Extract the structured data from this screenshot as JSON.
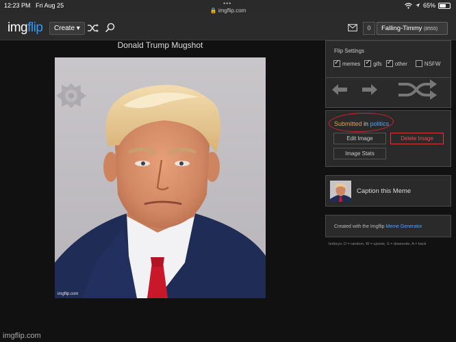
{
  "status_bar": {
    "time": "12:23 PM",
    "date": "Fri Aug 25",
    "url": "🔒 imgflip.com",
    "battery_text": "65%",
    "battery_level": 0.65
  },
  "header": {
    "logo_main": "img",
    "logo_accent": "flip",
    "create_label": "Create ▾",
    "notif_count": "0",
    "username": "Falling-Timmy",
    "user_tag": "(8555)"
  },
  "meme": {
    "title": "Donald Trump Mugshot",
    "watermark": "imgflip.com"
  },
  "flip_settings": {
    "title": "Flip Settings",
    "options": [
      {
        "label": "memes",
        "checked": true
      },
      {
        "label": "gifs",
        "checked": true
      },
      {
        "label": "other",
        "checked": true
      },
      {
        "label": "NSFW",
        "checked": false
      }
    ]
  },
  "submission": {
    "submitted_word": "Submitted",
    "in_word": "in",
    "stream": "politics",
    "edit_label": "Edit Image",
    "delete_label": "Delete Image",
    "stats_label": "Image Stats"
  },
  "caption": {
    "label": "Caption this Meme"
  },
  "created": {
    "prefix": "Created with the Imgflip",
    "link": "Meme Generator"
  },
  "hotkeys": "hotkeys: D = random, W = upvote, S = downvote, A = back",
  "footer_url": "imgflip.com"
}
